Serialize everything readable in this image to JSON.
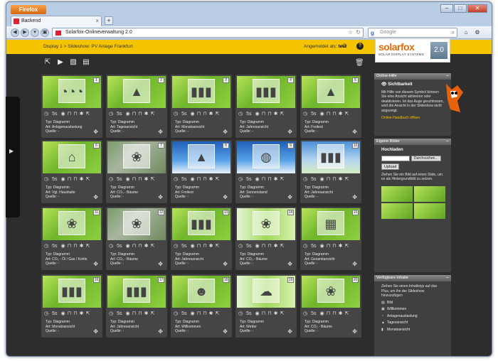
{
  "browser": {
    "app_button": "Firefox",
    "tab_title": "Backend",
    "url": "Solarfox-Onlineverwaltung 2.0",
    "search_placeholder": "Google"
  },
  "header": {
    "breadcrumb": "Display 1 > Slideshow: PV Anlage Frankfurt",
    "logged_in_label": "Angemeldet als:",
    "user": "test",
    "logo_brand": "solarfox",
    "logo_sub": "SOLAR DISPLAY SYSTEMS",
    "version": "2.0"
  },
  "slides": [
    {
      "num": "1",
      "icon": "◔◔◔",
      "bg": "green",
      "duration": "5s",
      "typ": "Typ: Diagramm",
      "art": "Art: Anlagenauslastung",
      "quelle": "Quelle: -"
    },
    {
      "num": "2",
      "icon": "▲",
      "bg": "green",
      "duration": "5s",
      "typ": "Typ: Diagramm",
      "art": "Art: Tagesansicht",
      "quelle": "Quelle: -"
    },
    {
      "num": "3",
      "icon": "▮▮▮",
      "bg": "green",
      "duration": "5s",
      "typ": "Typ: Diagramm",
      "art": "Art: Monatsansicht",
      "quelle": "Quelle: -"
    },
    {
      "num": "4",
      "icon": "▮▮▮",
      "bg": "green",
      "duration": "5s",
      "typ": "Typ: Diagramm",
      "art": "Art: Jahresansicht",
      "quelle": "Quelle: -"
    },
    {
      "num": "5",
      "icon": "▲",
      "bg": "green",
      "duration": "5s",
      "typ": "Typ: Diagramm",
      "art": "Art: Freitext",
      "quelle": "Quelle: -"
    },
    {
      "num": "6",
      "icon": "⌂",
      "bg": "green",
      "duration": "5s",
      "typ": "Typ: Diagramm",
      "art": "Art: Vgl. Haushalte",
      "quelle": "Quelle: -"
    },
    {
      "num": "7",
      "icon": "❀",
      "bg": "road",
      "duration": "5s",
      "typ": "Typ: Diagramm",
      "art": "Art: CO₂ - Bäume",
      "quelle": "Quelle: -"
    },
    {
      "num": "8",
      "icon": "▲",
      "bg": "sky",
      "duration": "5s",
      "typ": "Typ: Diagramm",
      "art": "Art: Freitext",
      "quelle": "Quelle: -"
    },
    {
      "num": "9",
      "icon": "◍",
      "bg": "sky",
      "duration": "5s",
      "typ": "Typ: Diagramm",
      "art": "Art: Sonnenstand",
      "quelle": "Quelle: -"
    },
    {
      "num": "10",
      "icon": "▮▮▮",
      "bg": "sky2",
      "duration": "5s",
      "typ": "Typ: Diagramm",
      "art": "Art: Jahresansicht",
      "quelle": "Quelle: -"
    },
    {
      "num": "11",
      "icon": "❀",
      "bg": "green",
      "duration": "5s",
      "typ": "Typ: Diagramm",
      "art": "Art: CO₂ - Öl / Gas / Kohle",
      "quelle": "Quelle: -"
    },
    {
      "num": "12",
      "icon": "❀",
      "bg": "road",
      "duration": "5s",
      "typ": "Typ: Diagramm",
      "art": "Art: CO₂ - Bäume",
      "quelle": "Quelle: -"
    },
    {
      "num": "13",
      "icon": "▮▮▮",
      "bg": "green",
      "duration": "5s",
      "typ": "Typ: Diagramm",
      "art": "Art: Jahresansicht",
      "quelle": "Quelle: -"
    },
    {
      "num": "14",
      "icon": "❀",
      "bg": "white",
      "duration": "5s",
      "typ": "Typ: Diagramm",
      "art": "Art: CO₂ - Bäume",
      "quelle": "Quelle: -"
    },
    {
      "num": "15",
      "icon": "▦",
      "bg": "green",
      "duration": "5s",
      "typ": "Typ: Diagramm",
      "art": "Art: Gesamtansicht",
      "quelle": "Quelle: -"
    },
    {
      "num": "16",
      "icon": "▮▮▮",
      "bg": "green",
      "duration": "5s",
      "typ": "Typ: Diagramm",
      "art": "Art: Monatsansicht",
      "quelle": "Quelle: -"
    },
    {
      "num": "17",
      "icon": "▮▮▮",
      "bg": "green",
      "duration": "5s",
      "typ": "Typ: Diagramm",
      "art": "Art: Jahresansicht",
      "quelle": "Quelle: -"
    },
    {
      "num": "18",
      "icon": "☻☻",
      "bg": "green",
      "duration": "5s",
      "typ": "Typ: Diagramm",
      "art": "Art: Willkommen",
      "quelle": "Quelle: -"
    },
    {
      "num": "19",
      "icon": "☁",
      "bg": "white",
      "duration": "5s",
      "typ": "Typ: Diagramm",
      "art": "Art: Wetter",
      "quelle": "Quelle: -"
    },
    {
      "num": "20",
      "icon": "❀",
      "bg": "green",
      "duration": "5s",
      "typ": "Typ: Diagramm",
      "art": "Art: CO₂ - Bäume",
      "quelle": "Quelle: -"
    }
  ],
  "panels": {
    "online_hilfe": {
      "title": "Online-Hilfe",
      "heading": "Sichtbarkeit",
      "text": "Mit Hilfe von diesem Symbol können Sie eine Ansicht aktivieren oder deaktivieren. Ist das Auge geschlossen, wird die Ansicht in der Slideshow nicht angezeigt.",
      "link": "Online-Handbuch öffnen"
    },
    "eigene_bilder": {
      "title": "Eigene Bilder",
      "heading": "Hochladen",
      "browse": "Durchsuchen...",
      "upload": "Upload",
      "text": "Ziehen Sie ein Bild auf einen Slide, um es als Hintergrundbild zu setzen."
    },
    "inhalte": {
      "title": "Verfügbare Inhalte",
      "text": "Ziehen Sie einen Inhaltstyp auf das Plus, um ihn der Slideshow hinzuzufügen",
      "items": [
        "Bild",
        "Willkommen",
        "Anlagenauslastung",
        "Tagesansicht",
        "Monatsansicht"
      ]
    }
  }
}
